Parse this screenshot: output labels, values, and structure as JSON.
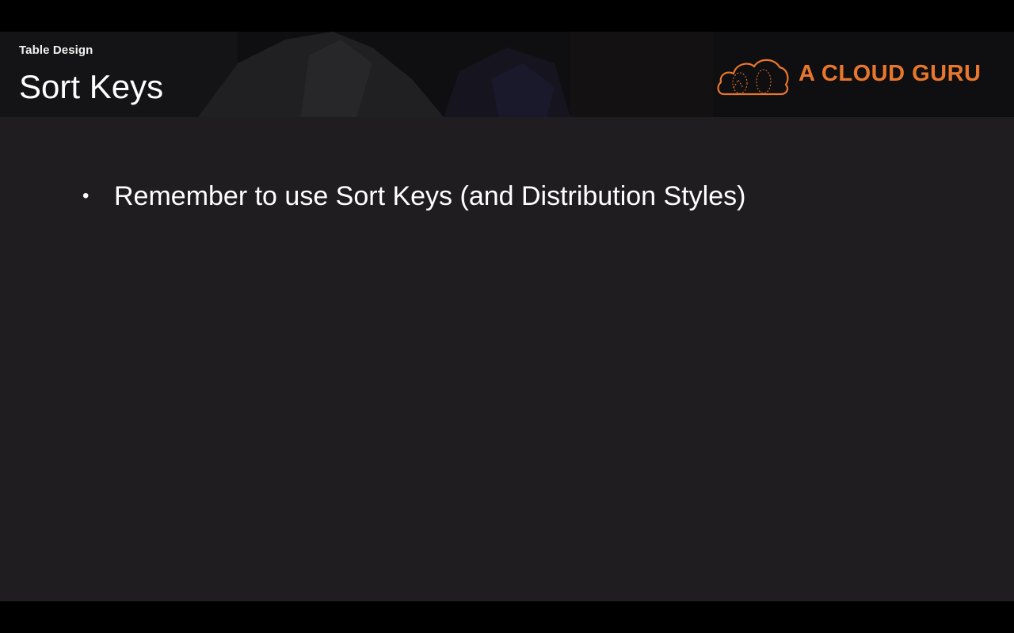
{
  "slide": {
    "kicker": "Table Design",
    "title": "Sort Keys",
    "logo": {
      "icon": "cloud-icon",
      "text": "A CLOUD GURU",
      "color": "#e8772e"
    },
    "bullets": [
      {
        "text": "Remember to use Sort Keys (and Distribution Styles)"
      }
    ]
  },
  "colors": {
    "slide_background": "#1f1d20",
    "letterbox": "#000000",
    "text": "#ffffff",
    "accent": "#e8772e"
  }
}
